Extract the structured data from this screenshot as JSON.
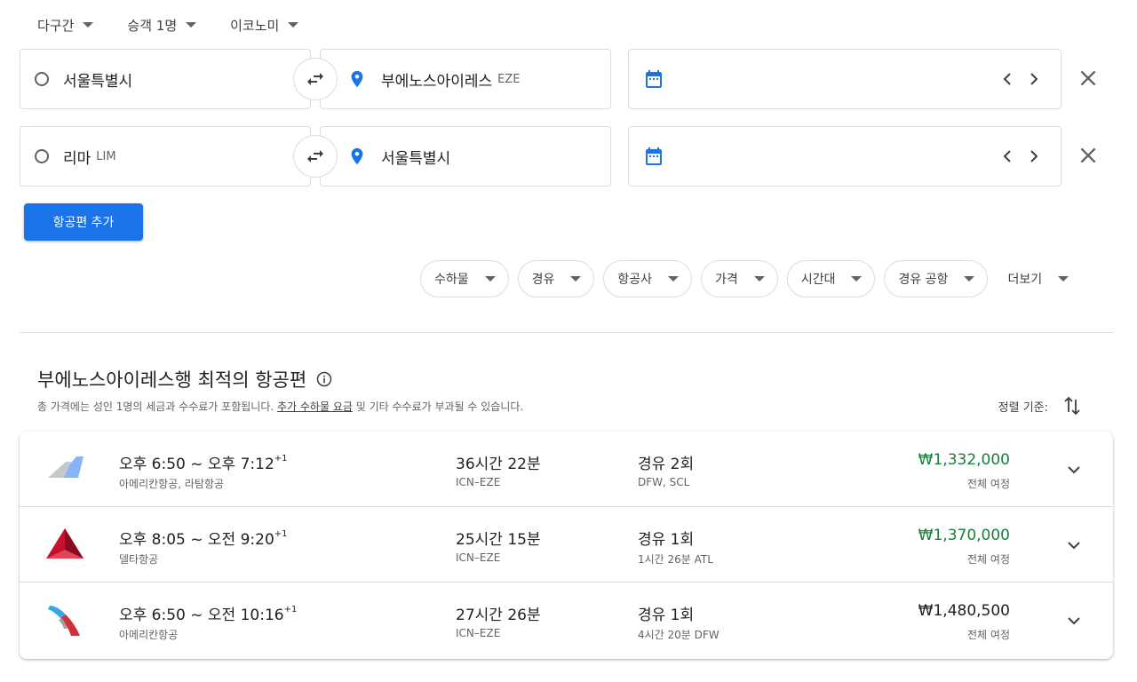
{
  "top": {
    "trip_type": "다구간",
    "passengers": "승객 1명",
    "cabin": "이코노미"
  },
  "legs": [
    {
      "origin": "서울특별시",
      "origin_code": "",
      "destination": "부에노스아이레스",
      "destination_code": "EZE"
    },
    {
      "origin": "리마",
      "origin_code": "LIM",
      "destination": "서울특별시",
      "destination_code": ""
    }
  ],
  "add_flight_label": "항공편 추가",
  "filters": {
    "chips": [
      "수하물",
      "경유",
      "항공사",
      "가격",
      "시간대",
      "경유 공항"
    ],
    "more_label": "더보기"
  },
  "results": {
    "title": "부에노스아이레스행 최적의 항공편",
    "subtitle_pre": "총 가격에는 성인 1명의 세금과 수수료가 포함됩니다. ",
    "subtitle_link": "추가 수하물 요금",
    "subtitle_post": " 및 기타 수수료가 부과될 수 있습니다.",
    "sort_label": "정렬 기준:",
    "flights": [
      {
        "logo": "latam-american-logo",
        "depart": "오후 6:50",
        "sep": " ~ ",
        "arrive": "오후 7:12",
        "day_offset": "+1",
        "airline": "아메리칸항공, 라탐항공",
        "duration": "36시간 22분",
        "route": "ICN–EZE",
        "stops": "경유 2회",
        "stop_detail": "DFW, SCL",
        "price": "₩1,332,000",
        "price_color": "#188038",
        "price_type": "전체 여정"
      },
      {
        "logo": "delta-logo",
        "depart": "오후 8:05",
        "sep": " ~ ",
        "arrive": "오전 9:20",
        "day_offset": "+1",
        "airline": "델타항공",
        "duration": "25시간 15분",
        "route": "ICN–EZE",
        "stops": "경유 1회",
        "stop_detail": "1시간 26분 ATL",
        "price": "₩1,370,000",
        "price_color": "#188038",
        "price_type": "전체 여정"
      },
      {
        "logo": "american-airlines-logo",
        "depart": "오후 6:50",
        "sep": " ~ ",
        "arrive": "오전 10:16",
        "day_offset": "+1",
        "airline": "아메리칸항공",
        "duration": "27시간 26분",
        "route": "ICN–EZE",
        "stops": "경유 1회",
        "stop_detail": "4시간 20분 DFW",
        "price": "₩1,480,500",
        "price_color": "#202124",
        "price_type": "전체 여정"
      }
    ]
  }
}
